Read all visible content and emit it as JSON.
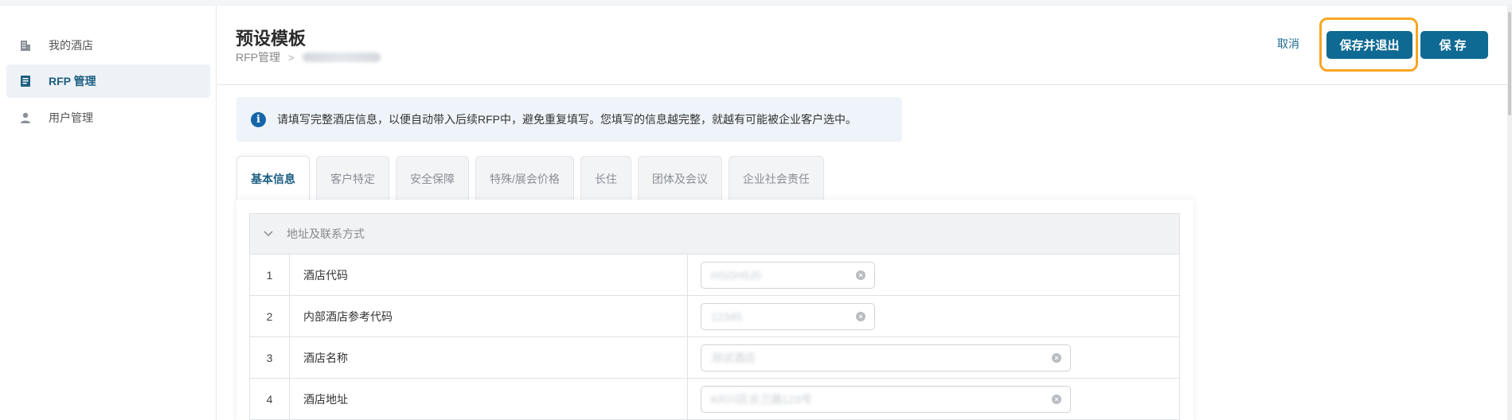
{
  "sidebar": {
    "items": [
      {
        "label": "我的酒店",
        "icon": "building-icon"
      },
      {
        "label": "RFP 管理",
        "icon": "document-icon"
      },
      {
        "label": "用户管理",
        "icon": "user-icon"
      }
    ]
  },
  "header": {
    "title": "预设模板",
    "breadcrumb_root": "RFP管理",
    "breadcrumb_current": "测试酒店酒店1",
    "cancel_label": "取消",
    "save_exit_label": "保存并退出",
    "save_label": "保存"
  },
  "banner": {
    "text": "请填写完整酒店信息，以便自动带入后续RFP中，避免重复填写。您填写的信息越完整，就越有可能被企业客户选中。"
  },
  "tabs": [
    {
      "label": "基本信息"
    },
    {
      "label": "客户特定"
    },
    {
      "label": "安全保障"
    },
    {
      "label": "特殊/展会价格"
    },
    {
      "label": "长住"
    },
    {
      "label": "团体及会议"
    },
    {
      "label": "企业社会责任"
    }
  ],
  "section": {
    "title": "地址及联系方式"
  },
  "rows": [
    {
      "num": "1",
      "label": "酒店代码",
      "value": "HSGH5J0"
    },
    {
      "num": "2",
      "label": "内部酒店参考代码",
      "value": "12345"
    },
    {
      "num": "3",
      "label": "酒店名称",
      "value": "测试酒店"
    },
    {
      "num": "4",
      "label": "酒店地址",
      "value": "KR川区长兰路123号"
    }
  ],
  "colors": {
    "primary": "#0f6a93",
    "focus_ring": "#f5a623",
    "active_nav": "#1c5e82",
    "banner_bg": "#eef4f9"
  }
}
